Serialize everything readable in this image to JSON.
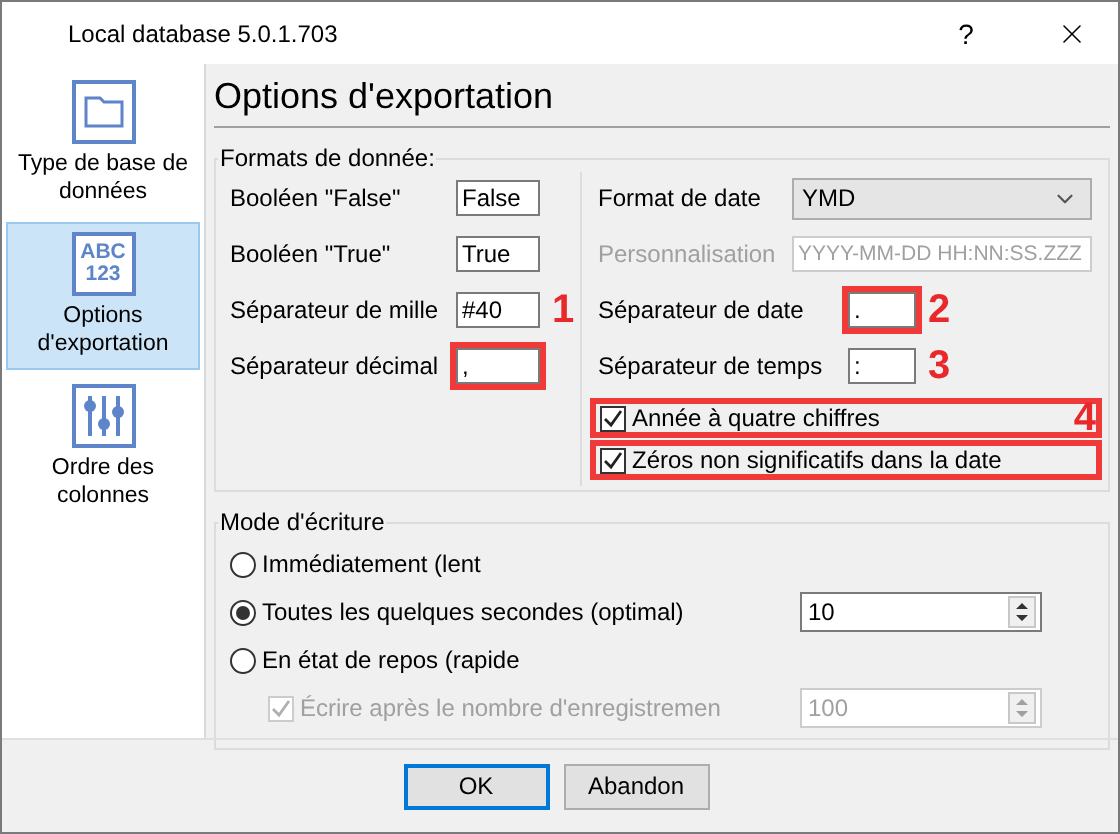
{
  "window": {
    "title": "Local database 5.0.1.703",
    "help": "?"
  },
  "sidebar": {
    "items": [
      {
        "label": "Type de base de données",
        "kind": "folder",
        "selected": false
      },
      {
        "label": "Options d'exportation",
        "kind": "letters",
        "icon_lines": [
          "ABC",
          "123"
        ],
        "selected": true
      },
      {
        "label": "Ordre des colonnes",
        "kind": "sliders",
        "selected": false
      }
    ]
  },
  "page_title": "Options d'exportation",
  "formats": {
    "legend": "Formats de donnée:",
    "left_fields": [
      {
        "label": "Booléen \"False\"",
        "value": "False",
        "highlighted": false
      },
      {
        "label": "Booléen \"True\"",
        "value": "True",
        "highlighted": false
      },
      {
        "label": "Séparateur de mille",
        "value": "#40",
        "highlighted": false,
        "callout": "1"
      },
      {
        "label": "Séparateur décimal",
        "value": ",",
        "highlighted": true
      }
    ],
    "date_format": {
      "label": "Format de date",
      "value": "YMD"
    },
    "custom": {
      "label": "Personnalisation",
      "value": "YYYY-MM-DD HH:NN:SS.ZZZ",
      "disabled": true
    },
    "right_fields": [
      {
        "label": "Séparateur de date",
        "value": ".",
        "highlighted": true,
        "callout": "2"
      },
      {
        "label": "Séparateur de temps",
        "value": ":",
        "highlighted": false,
        "callout": "3"
      }
    ],
    "checkboxes": [
      {
        "label": "Année à quatre chiffres",
        "checked": true,
        "highlighted": true,
        "callout": "4"
      },
      {
        "label": "Zéros non significatifs dans la date",
        "checked": true,
        "highlighted": true
      }
    ]
  },
  "write_mode": {
    "legend": "Mode d'écriture",
    "options": [
      {
        "label": "Immédiatement (lent",
        "selected": false
      },
      {
        "label": "Toutes les quelques secondes (optimal)",
        "selected": true,
        "spinner": "10"
      },
      {
        "label": "En état de repos (rapide",
        "selected": false
      }
    ],
    "sub_option": {
      "label": "Écrire après le nombre d'enregistremen",
      "checked": true,
      "disabled": true,
      "spinner": "100"
    }
  },
  "buttons": [
    {
      "label": "OK",
      "default": true
    },
    {
      "label": "Abandon",
      "default": false
    }
  ]
}
